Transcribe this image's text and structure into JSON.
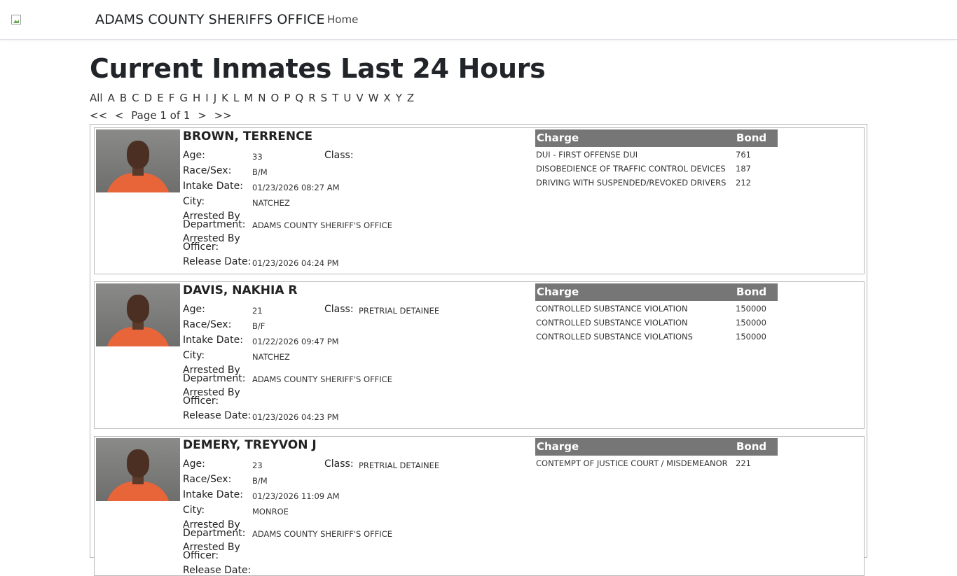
{
  "nav": {
    "brand": "ADAMS COUNTY SHERIFFS OFFICE",
    "home": "Home"
  },
  "page": {
    "title": "Current Inmates Last 24 Hours"
  },
  "letters": [
    "All",
    "A",
    "B",
    "C",
    "D",
    "E",
    "F",
    "G",
    "H",
    "I",
    "J",
    "K",
    "L",
    "M",
    "N",
    "O",
    "P",
    "Q",
    "R",
    "S",
    "T",
    "U",
    "V",
    "W",
    "X",
    "Y",
    "Z"
  ],
  "pager": {
    "first": "<<",
    "prev": "<",
    "label": "Page 1 of 1",
    "next": ">",
    "last": ">>"
  },
  "labels": {
    "age": "Age:",
    "class": "Class:",
    "race_sex": "Race/Sex:",
    "intake": "Intake Date:",
    "city": "City:",
    "arrested_dept_1": "Arrested By",
    "arrested_dept_2": "Department:",
    "arrested_off_1": "Arrested By",
    "arrested_off_2": "Officer:",
    "release": "Release Date:",
    "charge_header": "Charge",
    "bond_header": "Bond"
  },
  "inmates": [
    {
      "name": "BROWN, TERRENCE",
      "age": "33",
      "class": "",
      "race_sex": "B/M",
      "intake": "01/23/2026 08:27 AM",
      "city": "NATCHEZ",
      "department": "ADAMS COUNTY SHERIFF'S OFFICE",
      "officer": "",
      "release": "01/23/2026 04:24 PM",
      "charges": [
        {
          "charge": "DUI - FIRST OFFENSE DUI",
          "bond": "761"
        },
        {
          "charge": "DISOBEDIENCE OF TRAFFIC CONTROL DEVICES",
          "bond": "187"
        },
        {
          "charge": "DRIVING WITH SUSPENDED/REVOKED DRIVERS",
          "bond": "212"
        }
      ]
    },
    {
      "name": "DAVIS, NAKHIA R",
      "age": "21",
      "class": "PRETRIAL DETAINEE",
      "race_sex": "B/F",
      "intake": "01/22/2026 09:47 PM",
      "city": "NATCHEZ",
      "department": "ADAMS COUNTY SHERIFF'S OFFICE",
      "officer": "",
      "release": "01/23/2026 04:23 PM",
      "charges": [
        {
          "charge": "CONTROLLED SUBSTANCE VIOLATION",
          "bond": "150000"
        },
        {
          "charge": "CONTROLLED SUBSTANCE VIOLATION",
          "bond": "150000"
        },
        {
          "charge": "CONTROLLED SUBSTANCE VIOLATIONS",
          "bond": "150000"
        }
      ]
    },
    {
      "name": "DEMERY, TREYVON J",
      "age": "23",
      "class": "PRETRIAL DETAINEE",
      "race_sex": "B/M",
      "intake": "01/23/2026 11:09 AM",
      "city": "MONROE",
      "department": "ADAMS COUNTY SHERIFF'S OFFICE",
      "officer": "",
      "release": "",
      "charges": [
        {
          "charge": "CONTEMPT OF JUSTICE COURT / MISDEMEANOR",
          "bond": "221"
        }
      ]
    }
  ]
}
